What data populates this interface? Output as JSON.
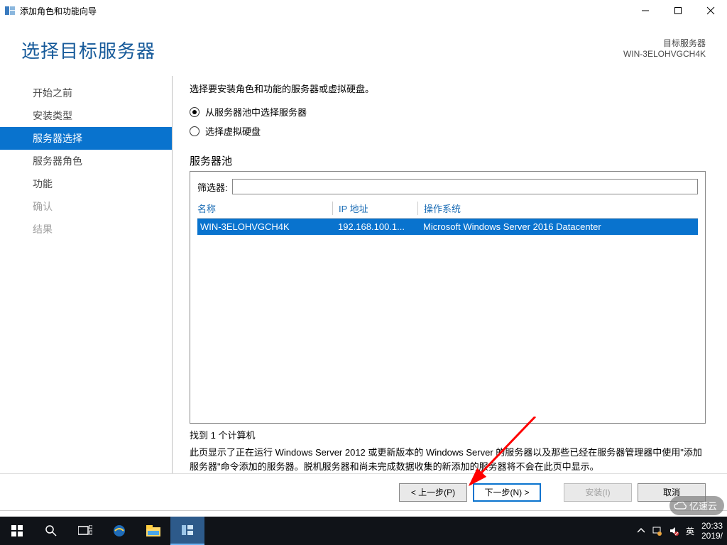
{
  "window": {
    "title": "添加角色和功能向导"
  },
  "header": {
    "page_title": "选择目标服务器",
    "target_label": "目标服务器",
    "target_name": "WIN-3ELOHVGCH4K"
  },
  "sidebar": {
    "items": [
      {
        "label": "开始之前",
        "state": "normal"
      },
      {
        "label": "安装类型",
        "state": "normal"
      },
      {
        "label": "服务器选择",
        "state": "selected"
      },
      {
        "label": "服务器角色",
        "state": "normal"
      },
      {
        "label": "功能",
        "state": "normal"
      },
      {
        "label": "确认",
        "state": "disabled"
      },
      {
        "label": "结果",
        "state": "disabled"
      }
    ]
  },
  "content": {
    "instruction": "选择要安装角色和功能的服务器或虚拟硬盘。",
    "radio_pool": "从服务器池中选择服务器",
    "radio_vhd": "选择虚拟硬盘",
    "pool_label": "服务器池",
    "filter_label": "筛选器:",
    "filter_value": "",
    "columns": {
      "name": "名称",
      "ip": "IP 地址",
      "os": "操作系统"
    },
    "rows": [
      {
        "name": "WIN-3ELOHVGCH4K",
        "ip": "192.168.100.1...",
        "os": "Microsoft Windows Server 2016 Datacenter"
      }
    ],
    "found": "找到 1 个计算机",
    "description": "此页显示了正在运行 Windows Server 2012 或更新版本的 Windows Server 的服务器以及那些已经在服务器管理器中使用\"添加服务器\"命令添加的服务器。脱机服务器和尚未完成数据收集的新添加的服务器将不会在此页中显示。"
  },
  "footer": {
    "prev": "< 上一步(P)",
    "next": "下一步(N) >",
    "install": "安装(I)",
    "cancel": "取消"
  },
  "taskbar": {
    "ime": "英",
    "time": "20:33",
    "date": "2019/"
  },
  "watermark": "亿速云"
}
